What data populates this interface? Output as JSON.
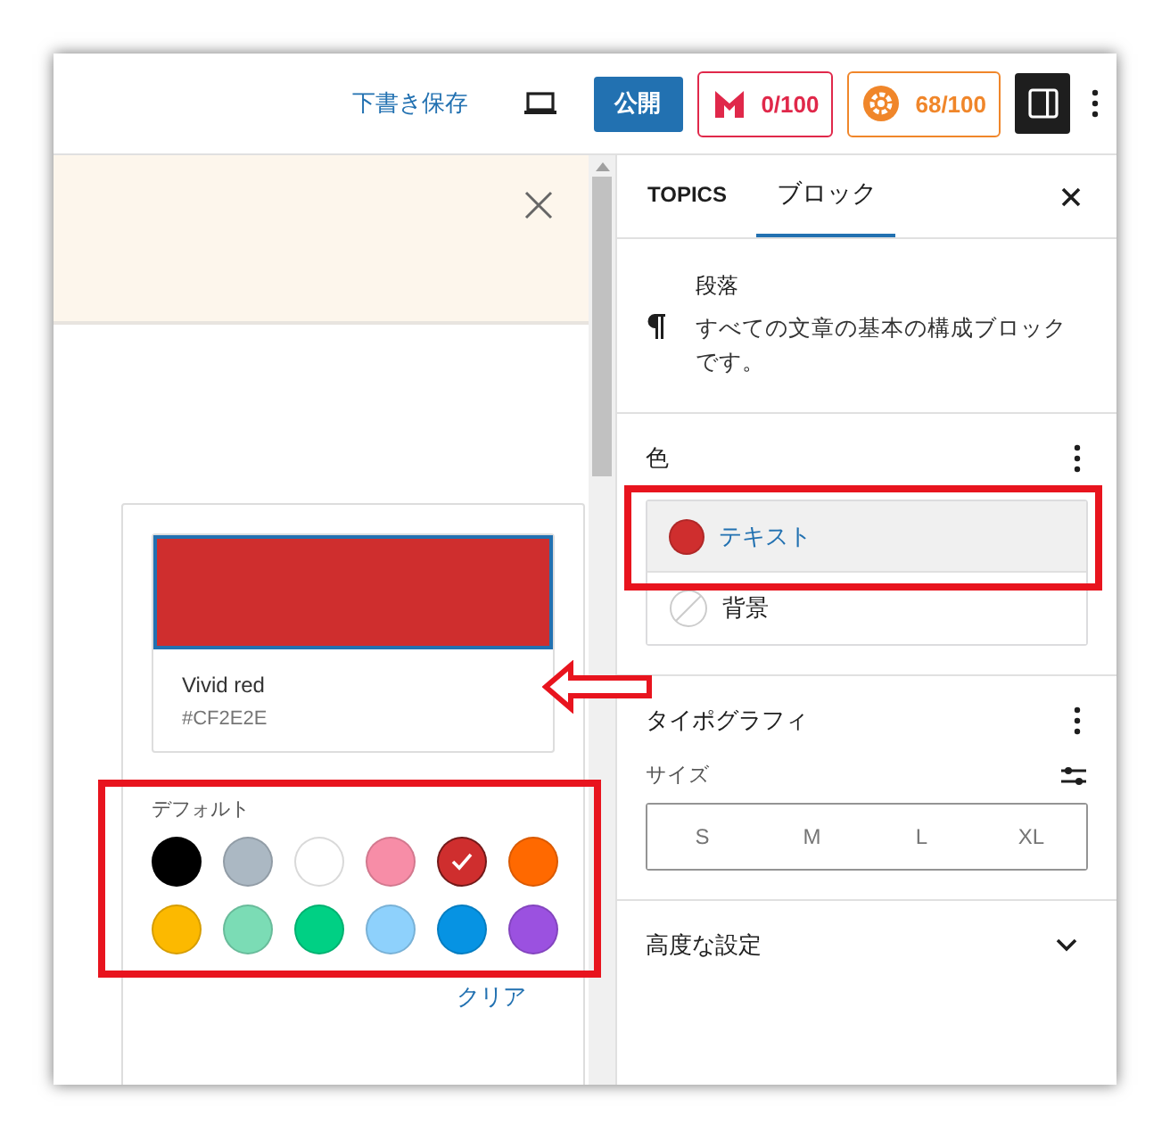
{
  "toolbar": {
    "save_draft": "下書き保存",
    "publish": "公開",
    "scores": [
      {
        "kind": "m",
        "value": "0/100",
        "color": "#e0284a"
      },
      {
        "kind": "gear",
        "value": "68/100",
        "color": "#f0862a"
      }
    ],
    "sidebar_toggle": {
      "selected": true
    }
  },
  "color_popover": {
    "selected_color": {
      "name": "Vivid red",
      "hex": "#CF2E2E",
      "color": "#cf2e2e"
    },
    "palette_label": "デフォルト",
    "swatches": [
      {
        "color": "#000000",
        "selected": false
      },
      {
        "color": "#abb8c3",
        "selected": false
      },
      {
        "color": "#ffffff",
        "selected": false
      },
      {
        "color": "#f78da7",
        "selected": false
      },
      {
        "color": "#cf2e2e",
        "selected": true
      },
      {
        "color": "#ff6900",
        "selected": false
      },
      {
        "color": "#fcb900",
        "selected": false
      },
      {
        "color": "#7bdcb5",
        "selected": false
      },
      {
        "color": "#00d084",
        "selected": false
      },
      {
        "color": "#8ed1fc",
        "selected": false
      },
      {
        "color": "#0693e3",
        "selected": false
      },
      {
        "color": "#9b51e0",
        "selected": false
      }
    ],
    "clear": "クリア"
  },
  "sidebar": {
    "tabs": [
      {
        "label": "TOPICS",
        "selected": false
      },
      {
        "label": "ブロック",
        "selected": true
      }
    ],
    "block": {
      "title": "段落",
      "description": "すべての文章の基本の構成ブロックです。"
    },
    "color_panel": {
      "title": "色",
      "items": [
        {
          "label": "テキスト",
          "selected": true,
          "color": "#cf2e2e"
        },
        {
          "label": "背景",
          "selected": false
        }
      ]
    },
    "typography": {
      "title": "タイポグラフィ",
      "size_label": "サイズ",
      "sizes": [
        {
          "label": "S",
          "selected": false
        },
        {
          "label": "M",
          "selected": false
        },
        {
          "label": "L",
          "selected": false
        },
        {
          "label": "XL",
          "selected": false
        }
      ]
    },
    "advanced": {
      "title": "高度な設定",
      "expanded": false
    }
  }
}
